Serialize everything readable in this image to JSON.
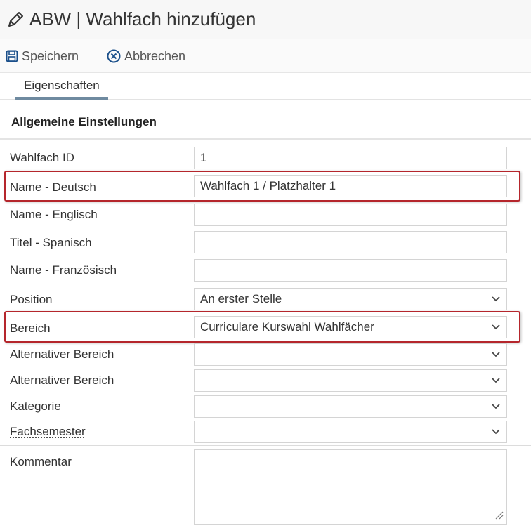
{
  "header": {
    "title": "ABW | Wahlfach hinzufügen",
    "icon": "pencil-icon"
  },
  "toolbar": {
    "save_label": "Speichern",
    "cancel_label": "Abbrechen"
  },
  "tabs": [
    {
      "label": "Eigenschaften",
      "active": true
    }
  ],
  "section": {
    "title": "Allgemeine Einstellungen"
  },
  "fields": {
    "wahlfach_id": {
      "label": "Wahlfach ID",
      "value": "1"
    },
    "name_de": {
      "label": "Name - Deutsch",
      "value": "Wahlfach 1 / Platzhalter 1"
    },
    "name_en": {
      "label": "Name - Englisch",
      "value": ""
    },
    "titel_es": {
      "label": "Titel - Spanisch",
      "value": ""
    },
    "name_fr": {
      "label": "Name - Französisch",
      "value": ""
    },
    "position": {
      "label": "Position",
      "value": "An erster Stelle"
    },
    "bereich": {
      "label": "Bereich",
      "value": "Curriculare Kurswahl Wahlfächer"
    },
    "alt_bereich_1": {
      "label": "Alternativer Bereich",
      "value": ""
    },
    "alt_bereich_2": {
      "label": "Alternativer Bereich",
      "value": ""
    },
    "kategorie": {
      "label": "Kategorie",
      "value": ""
    },
    "fachsemester": {
      "label": "Fachsemester",
      "value": ""
    },
    "kommentar": {
      "label": "Kommentar",
      "value": ""
    }
  },
  "colors": {
    "highlight": "#b5262c",
    "accent": "#1a4f8a",
    "tab_underline": "#6f8aa0"
  }
}
